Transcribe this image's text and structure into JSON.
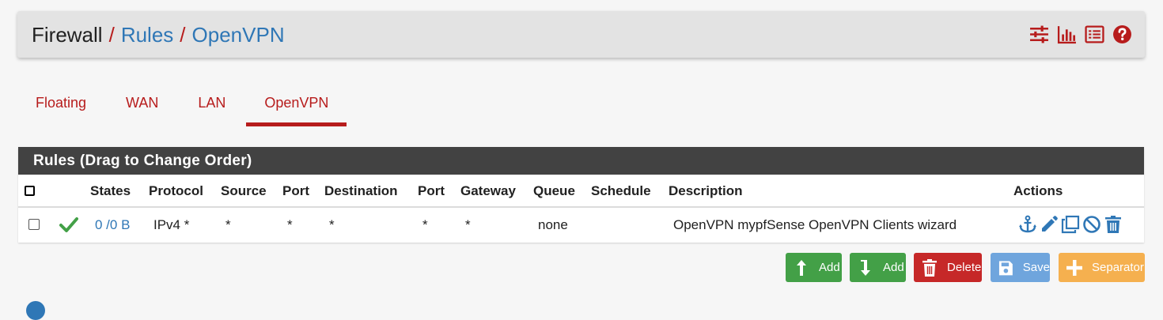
{
  "breadcrumb": {
    "root": "Firewall",
    "separator": "/",
    "level1": "Rules",
    "level2": "OpenVPN"
  },
  "header_icons": [
    "sliders-icon",
    "bar-chart-icon",
    "list-icon",
    "help-icon"
  ],
  "tabs": [
    {
      "label": "Floating",
      "active": false
    },
    {
      "label": "WAN",
      "active": false
    },
    {
      "label": "LAN",
      "active": false
    },
    {
      "label": "OpenVPN",
      "active": true
    }
  ],
  "panel": {
    "title": "Rules (Drag to Change Order)"
  },
  "table": {
    "columns": {
      "states": "States",
      "protocol": "Protocol",
      "source": "Source",
      "port1": "Port",
      "destination": "Destination",
      "port2": "Port",
      "gateway": "Gateway",
      "queue": "Queue",
      "schedule": "Schedule",
      "description": "Description",
      "actions": "Actions"
    },
    "rows": [
      {
        "checked": false,
        "status": "enabled",
        "states": "0 /0 B",
        "protocol": "IPv4 *",
        "source": "*",
        "port1": "*",
        "destination": "*",
        "port2": "*",
        "gateway": "*",
        "queue": "none",
        "schedule": "",
        "description": "OpenVPN mypfSense OpenVPN Clients wizard",
        "actions": [
          "anchor-icon",
          "pencil-icon",
          "copy-icon",
          "disable-icon",
          "trash-icon"
        ]
      }
    ]
  },
  "buttons": {
    "add_top": "Add",
    "add_bottom": "Add",
    "delete": "Delete",
    "save": "Save",
    "separator": "Separator"
  },
  "colors": {
    "accent_red": "#b71c1c",
    "link_blue": "#2f77b6",
    "green": "#43a047",
    "panel_header": "#424242",
    "orange": "#f5b04f"
  }
}
